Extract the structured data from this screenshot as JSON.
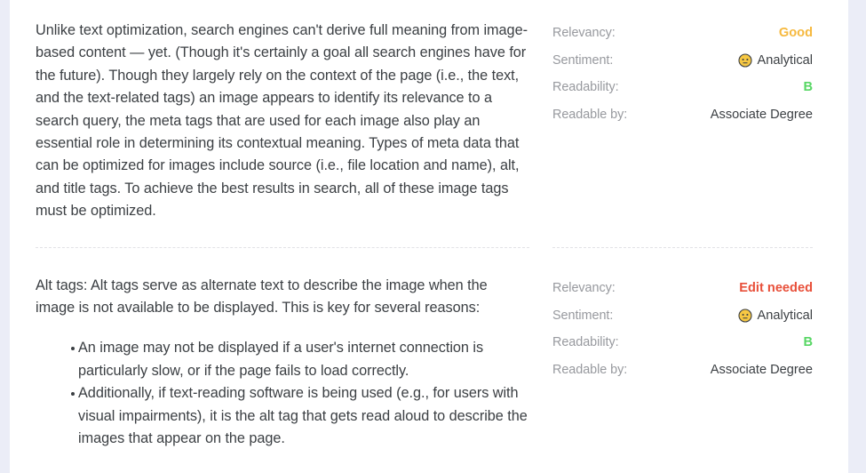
{
  "theme": {
    "page_background": "#ebedf7",
    "card_background": "#ffffff",
    "body_text": "#3b3f43",
    "label_text": "#97999e",
    "relevancy_good": "#f6b93f",
    "relevancy_warn": "#e8503a",
    "grade_green": "#56d663",
    "divider": "#e2e2e6",
    "face_fill": "#f7c843",
    "face_stroke": "#3b3f43"
  },
  "sections": [
    {
      "paragraph": "Unlike text optimization, search engines can't derive full meaning from image-based content — yet. (Though it's certainly a goal all search engines have for the future). Though they largely rely on the context of the page (i.e., the text, and the text-related tags) an image appears to identify its relevance to a search query, the meta tags that are used for each image also play an essential role in determining its contextual meaning. Types of meta data that can be optimized for images include source (i.e., file location and name), alt, and title tags. To achieve the best results in search, all of these image tags must be optimized.",
      "bullets": [],
      "metrics": {
        "relevancy_label": "Relevancy:",
        "relevancy_value": "Good",
        "relevancy_state": "good",
        "sentiment_label": "Sentiment:",
        "sentiment_value": "Analytical",
        "sentiment_icon": "neutral-face-icon",
        "readability_label": "Readability:",
        "readability_value": "B",
        "readable_by_label": "Readable by:",
        "readable_by_value": "Associate Degree"
      }
    },
    {
      "paragraph": "Alt tags: Alt tags serve as alternate text to describe the image when the image is not available to be displayed. This is key for several reasons:",
      "bullets": [
        "An image may not be displayed if a user's internet connection is particularly slow, or if the page fails to load correctly.",
        "Additionally, if text-reading software is being used (e.g., for users with visual impairments), it is the alt tag that gets read aloud to describe the images that appear on the page."
      ],
      "metrics": {
        "relevancy_label": "Relevancy:",
        "relevancy_value": "Edit needed",
        "relevancy_state": "warn",
        "sentiment_label": "Sentiment:",
        "sentiment_value": "Analytical",
        "sentiment_icon": "neutral-face-icon",
        "readability_label": "Readability:",
        "readability_value": "B",
        "readable_by_label": "Readable by:",
        "readable_by_value": "Associate Degree"
      }
    }
  ]
}
